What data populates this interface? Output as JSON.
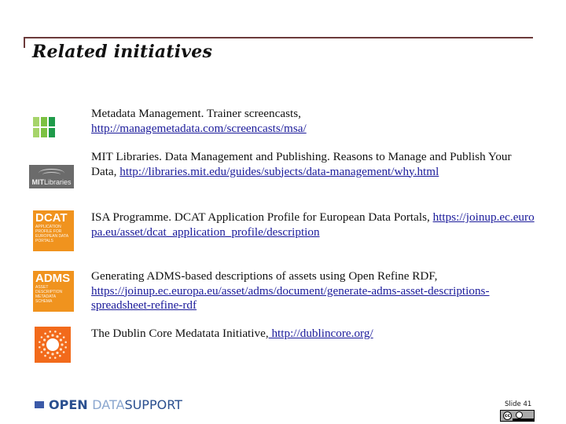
{
  "slide": {
    "title": "Related initiatives",
    "number_label": "Slide 41"
  },
  "items": [
    {
      "logo": "metadata-management-logo",
      "text": "Metadata Management. Trainer screencasts, ",
      "link": "http://managemetadata.com/screencasts/msa/"
    },
    {
      "logo": "mit-libraries-logo",
      "logo_text_bold": "MIT",
      "logo_text": "Libraries",
      "text": "MIT Libraries. Data Management and Publishing. Reasons to Manage and Publish Your Data, ",
      "link": "http://libraries.mit.edu/guides/subjects/data-management/why.html"
    },
    {
      "logo": "dcat-logo",
      "logo_title": "DCAT",
      "logo_subtitle": "Application profile for European data portals",
      "text": "ISA Programme. DCAT Application Profile for European Data Portals, ",
      "link": "https://joinup.ec.europa.eu/asset/dcat_application_profile/description"
    },
    {
      "logo": "adms-logo",
      "logo_title": "ADMS",
      "logo_subtitle": "Asset description metadata schema",
      "text": "Generating ADMS-based descriptions of assets using Open Refine RDF, ",
      "link": "https://joinup.ec.europa.eu/asset/adms/document/generate-adms-asset-descriptions-spreadsheet-refine-rdf"
    },
    {
      "logo": "dublin-core-logo",
      "text": "The Dublin Core Medatata Initiative,",
      "link": " http://dublincore.org/"
    }
  ],
  "footer": {
    "brand_open": "OPEN ",
    "brand_data": "DATA",
    "brand_support": "SUPPORT",
    "license_badge": "CC BY"
  },
  "colors": {
    "frame": "#6b3a3a",
    "link": "#1a1a9a",
    "orange": "#f0931e",
    "dublin_core": "#f26a1b",
    "brand_dark": "#2a4f8f",
    "brand_light": "#8aa6cf"
  }
}
